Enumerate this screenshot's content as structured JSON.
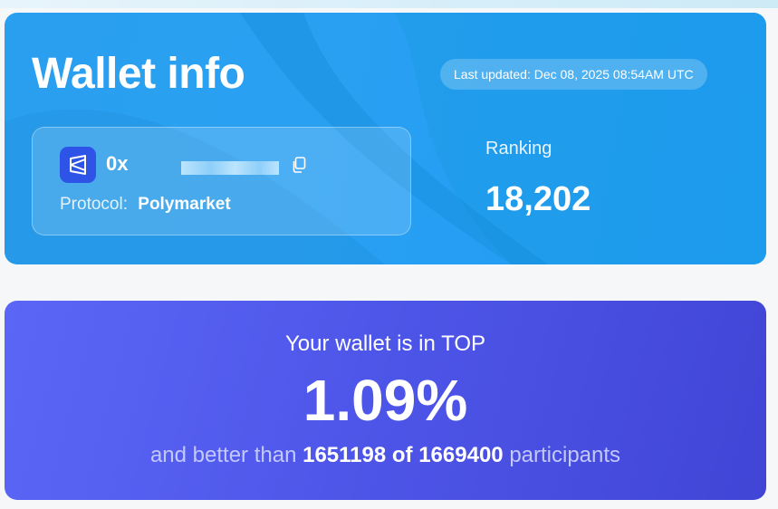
{
  "wallet": {
    "title": "Wallet info",
    "last_updated": "Last updated: Dec 08, 2025 08:54AM UTC",
    "address_prefix": "0x",
    "protocol_label": "Protocol:",
    "protocol_value": "Polymarket",
    "ranking_label": "Ranking",
    "ranking_value": "18,202",
    "logo_icon": "polymarket-logo-icon",
    "copy_icon": "copy-icon"
  },
  "top": {
    "heading": "Your wallet is in TOP",
    "percent": "1.09%",
    "prefix": "and better than",
    "better_count": "1651198",
    "of_word": "of",
    "total": "1669400",
    "suffix": "participants"
  },
  "colors": {
    "wallet_card_bg": "#2aa0f2",
    "top_card_bg": "#4d55e8",
    "logo_bg": "#2d54e6",
    "muted_text": "#c3c8ff"
  }
}
